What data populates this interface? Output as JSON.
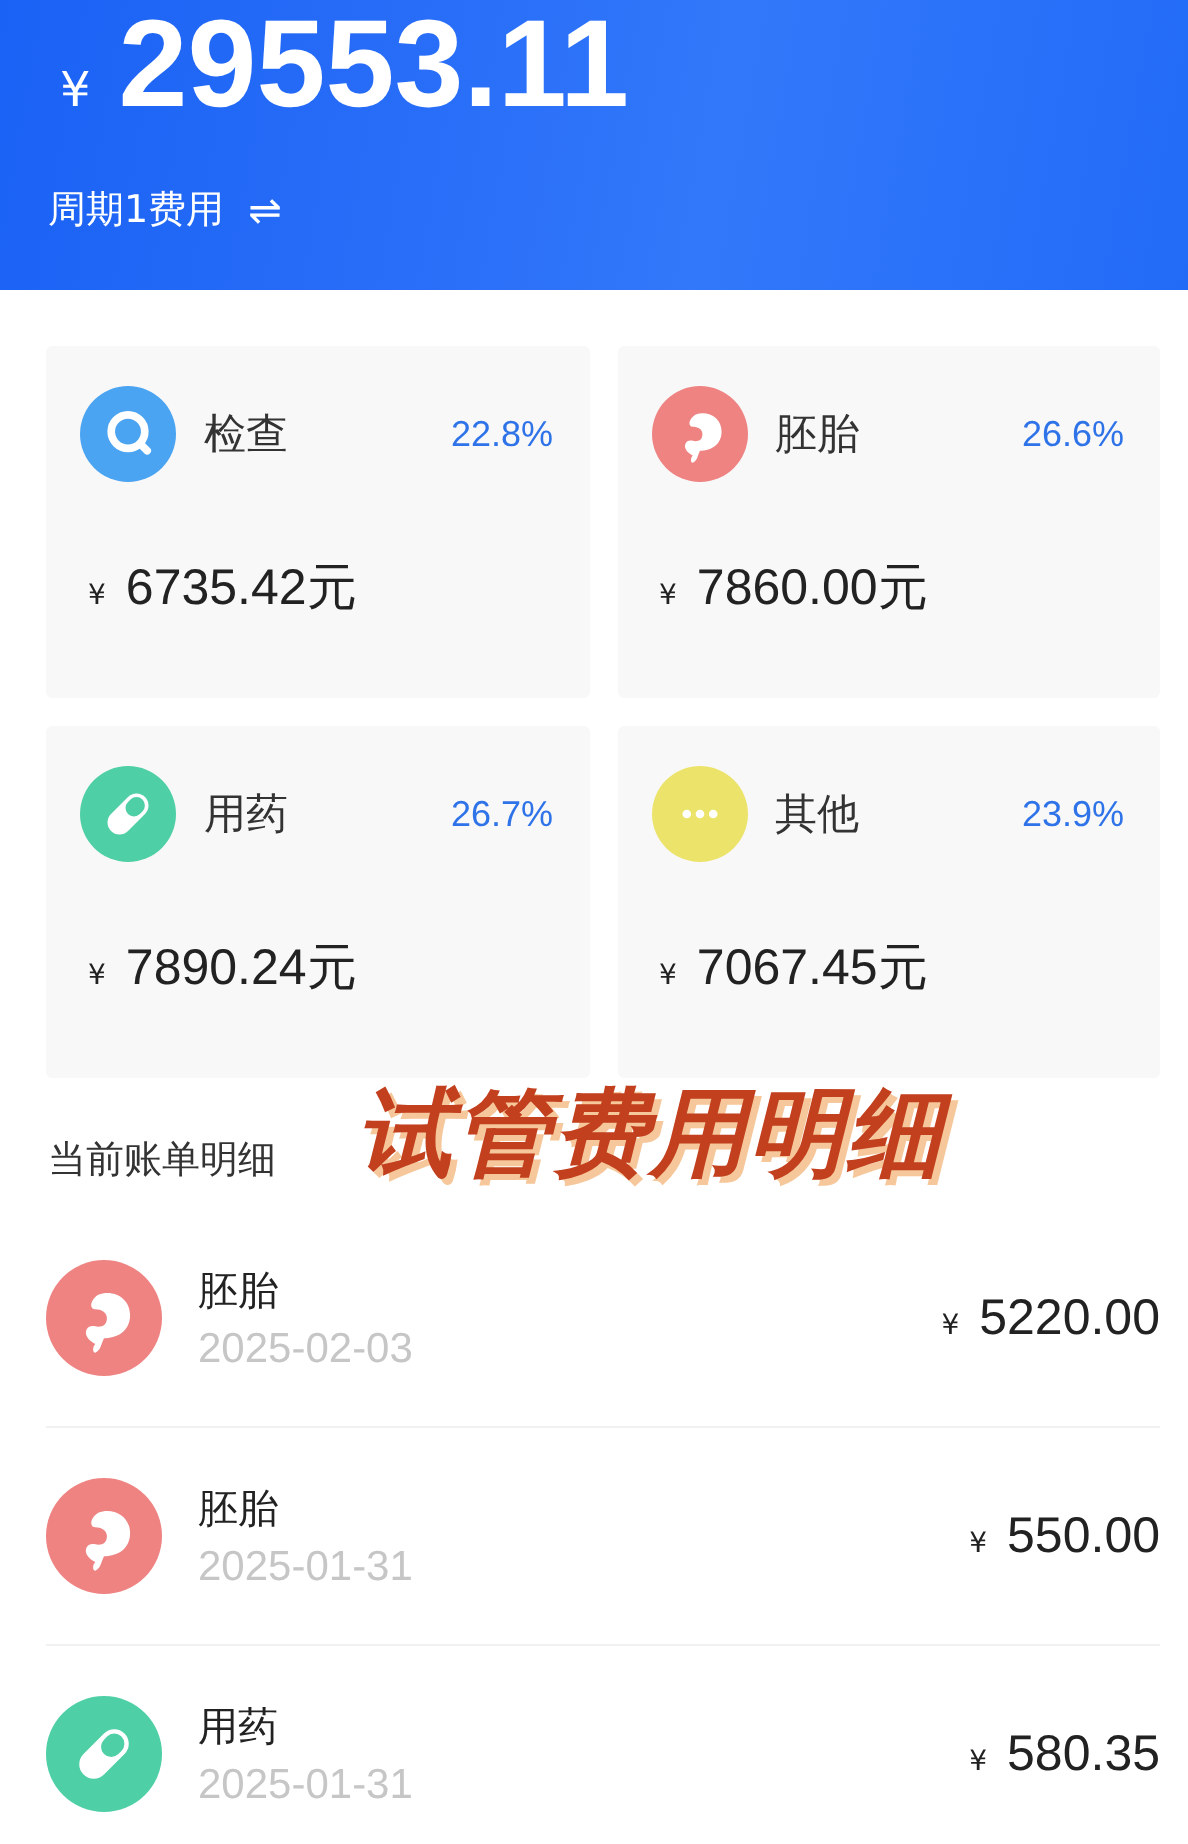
{
  "header": {
    "currency": "¥",
    "total": "29553.11",
    "period": "周期1费用",
    "switch_icon": "⇌"
  },
  "categories": [
    {
      "kind": "search",
      "name": "检查",
      "percent": "22.8%",
      "currency": "¥",
      "amount": "6735.42元",
      "color": "#4ba4f2"
    },
    {
      "kind": "embryo",
      "name": "胚胎",
      "percent": "26.6%",
      "currency": "¥",
      "amount": "7860.00元",
      "color": "#ee8382"
    },
    {
      "kind": "pill",
      "name": "用药",
      "percent": "26.7%",
      "currency": "¥",
      "amount": "7890.24元",
      "color": "#4fcfa5"
    },
    {
      "kind": "more",
      "name": "其他",
      "percent": "23.9%",
      "currency": "¥",
      "amount": "7067.45元",
      "color": "#ece36b"
    }
  ],
  "section_title": "当前账单明细",
  "caption": "试管费用明细",
  "bills": [
    {
      "kind": "embryo",
      "name": "胚胎",
      "date": "2025-02-03",
      "currency": "¥",
      "amount": "5220.00",
      "color": "#ee8382"
    },
    {
      "kind": "embryo",
      "name": "胚胎",
      "date": "2025-01-31",
      "currency": "¥",
      "amount": "550.00",
      "color": "#ee8382"
    },
    {
      "kind": "pill",
      "name": "用药",
      "date": "2025-01-31",
      "currency": "¥",
      "amount": "580.35",
      "color": "#4fcfa5"
    }
  ]
}
